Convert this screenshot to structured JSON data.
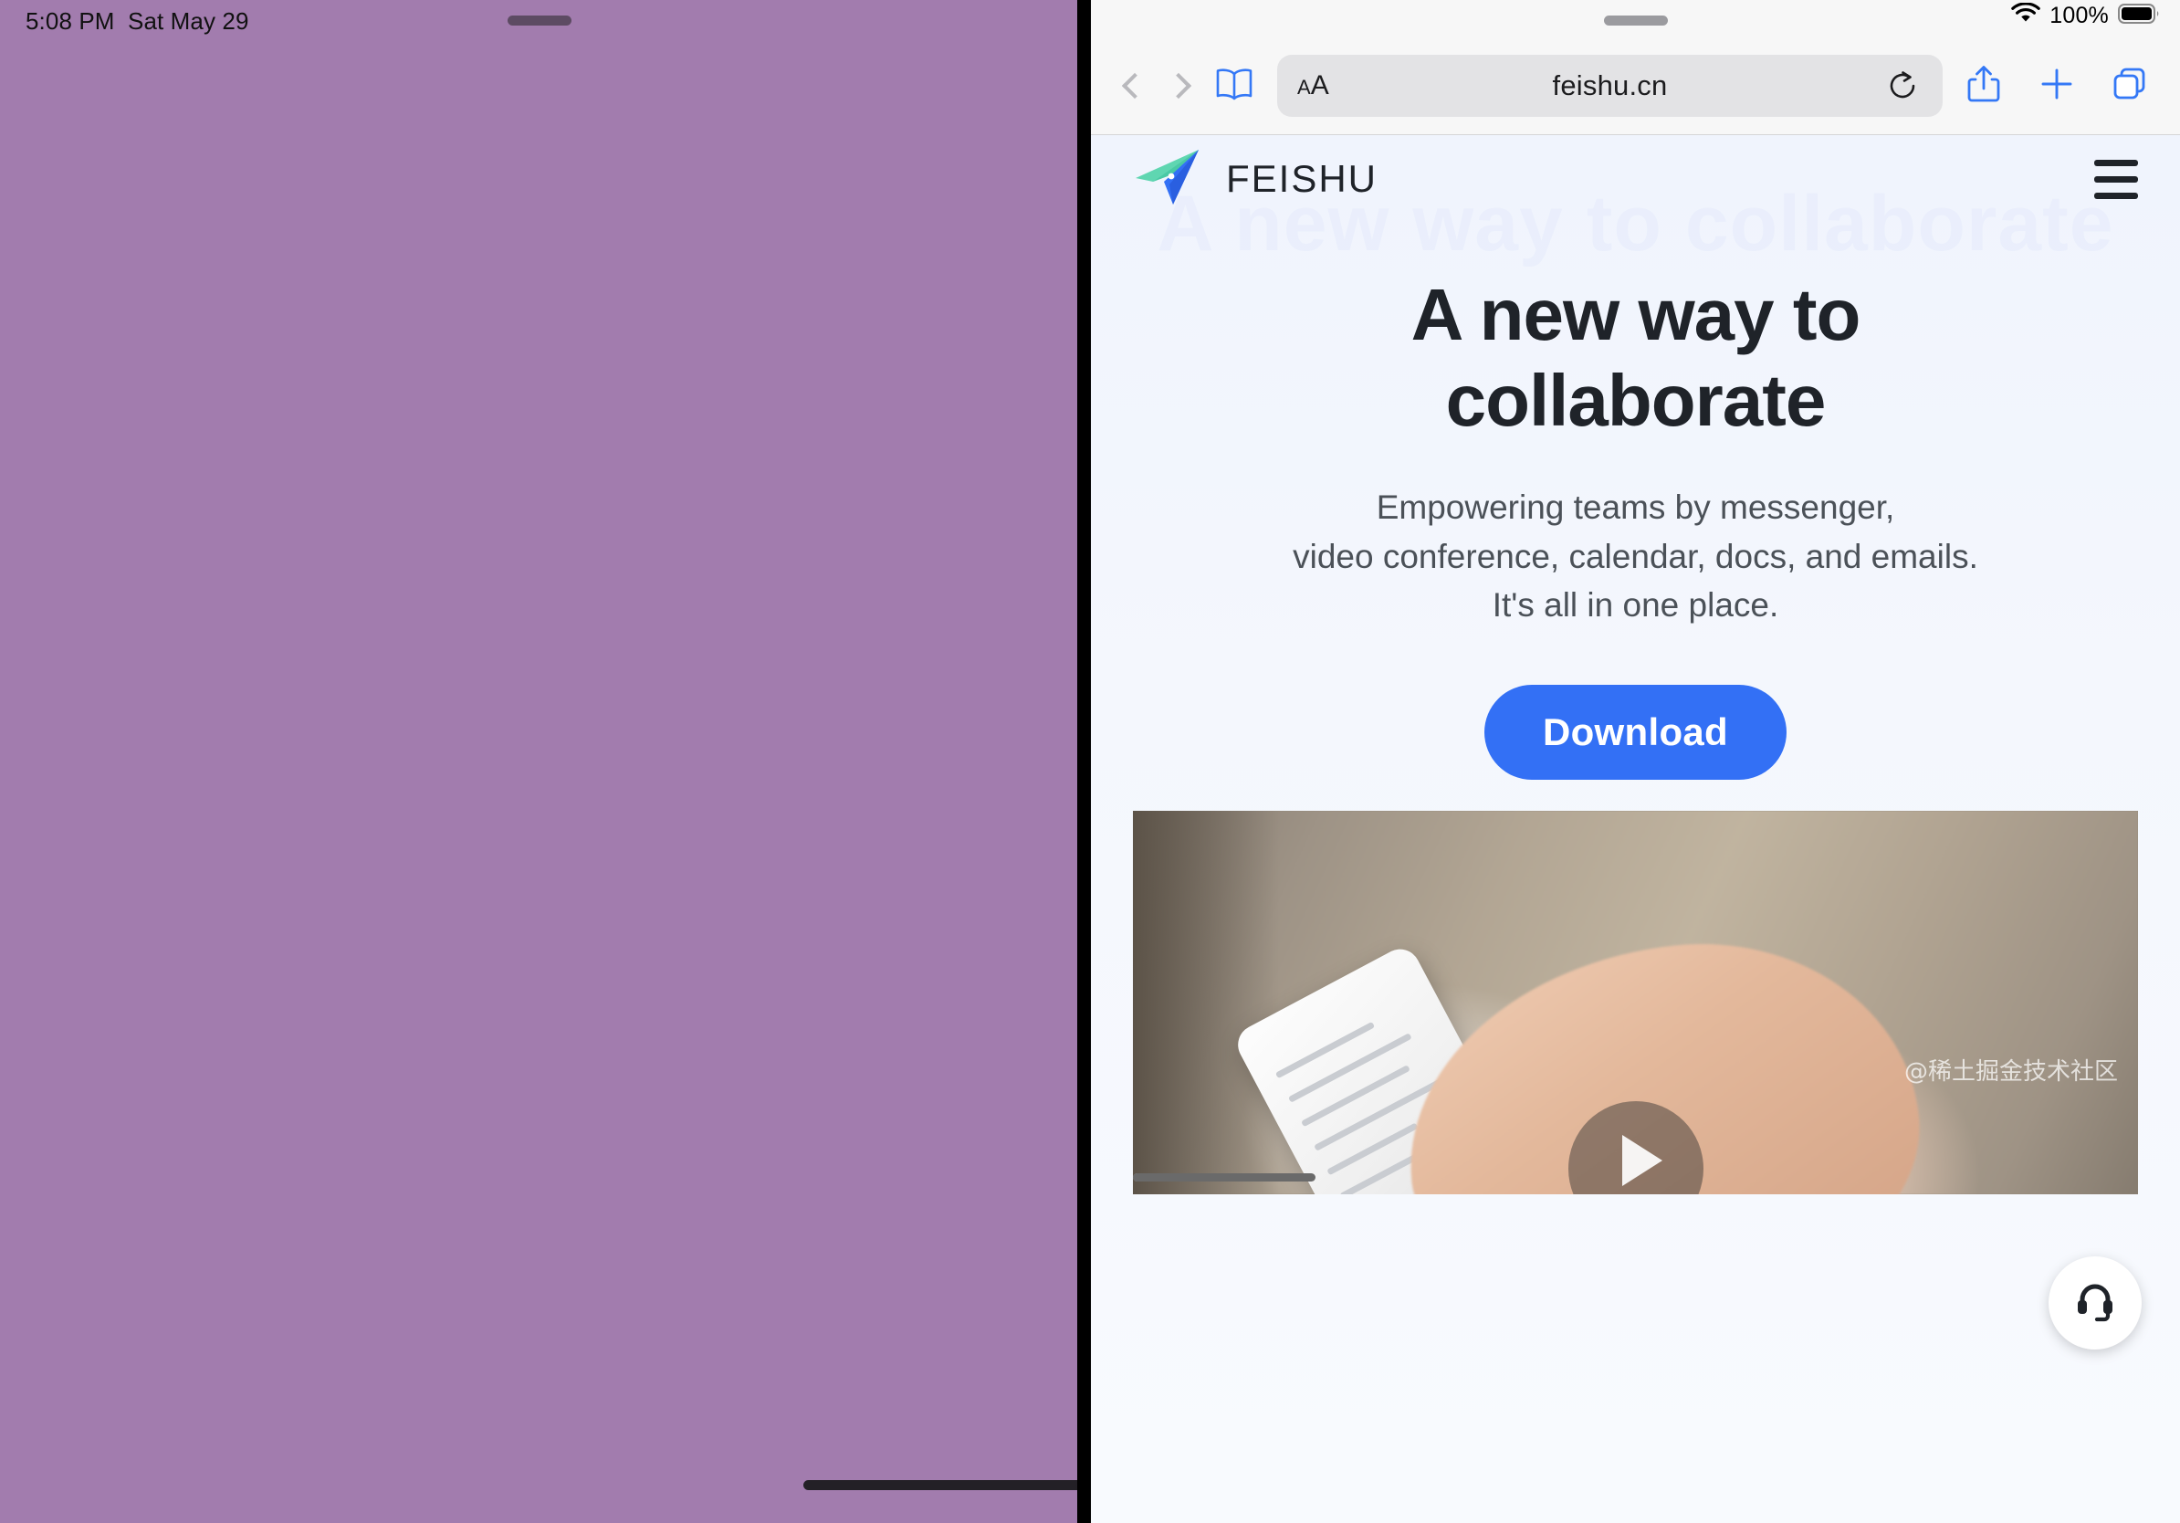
{
  "left_pane": {
    "background_color": "#a27cae",
    "status_bar": {
      "time": "5:08 PM",
      "date": "Sat May 29"
    }
  },
  "safari": {
    "status_bar": {
      "battery_percent": "100%",
      "wifi_icon": "wifi-icon",
      "battery_icon": "battery-full-icon"
    },
    "toolbar": {
      "back_icon": "chevron-left-icon",
      "forward_icon": "chevron-right-icon",
      "bookmarks_icon": "book-icon",
      "text_size_small": "A",
      "text_size_large": "A",
      "url": "feishu.cn",
      "reload_icon": "reload-icon",
      "share_icon": "share-icon",
      "new_tab_icon": "plus-icon",
      "tabs_icon": "tabs-icon"
    },
    "accent_color": "#3478f6"
  },
  "page": {
    "brand": {
      "name": "FEISHU",
      "logo_icon": "paper-plane-logo"
    },
    "menu_icon": "hamburger-menu-icon",
    "ghost_heading": "A new way to collaborate",
    "hero": {
      "title": "A new way to collaborate",
      "title_line1": "A new way to",
      "title_line2": "collaborate",
      "subtitle_line1": "Empowering teams by messenger,",
      "subtitle_line2": "video conference, calendar, docs, and emails.",
      "subtitle_line3": "It's all in one place.",
      "cta_label": "Download",
      "cta_color": "#3370f5"
    },
    "video": {
      "play_icon": "play-button-icon",
      "description": "hand holding smartphone"
    },
    "support_icon": "headset-icon",
    "watermark": "@稀土掘金技术社区"
  }
}
